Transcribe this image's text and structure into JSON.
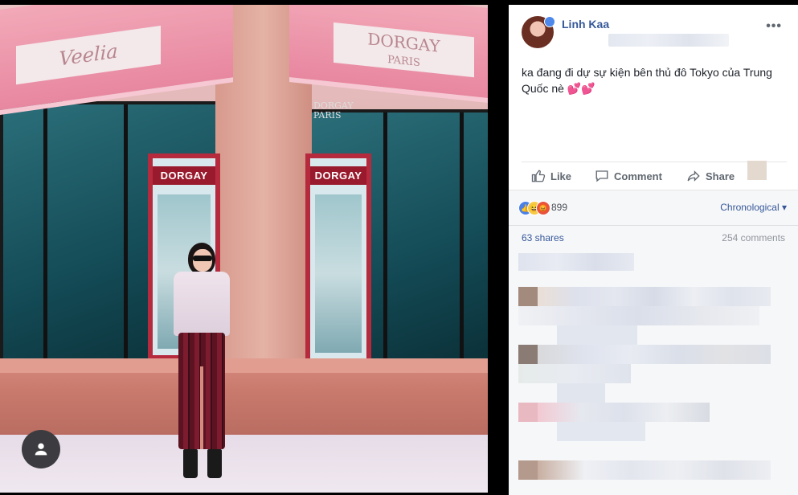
{
  "photo": {
    "awning_left_text": "Veelia",
    "awning_right_top": "DORGAY",
    "awning_right_sub": "PARIS",
    "store_sign": "DORGAY",
    "store_sign_sub": "PARIS",
    "poster_left_title": "DORGAY",
    "poster_right_title": "DORGAY",
    "badge_icon": "person-icon"
  },
  "post": {
    "author": "Linh Kaa",
    "more_icon": "•••",
    "text": "ka đang đi dự sự kiện bên thủ đô Tokyo của Trung Quốc nè",
    "emoji": "💕💕",
    "actions": {
      "like": "Like",
      "comment": "Comment",
      "share": "Share"
    },
    "reaction_count": "899",
    "sort_label": "Chronological",
    "sort_caret": "▾",
    "shares": "63 shares",
    "comments": "254 comments"
  },
  "colors": {
    "link": "#365899",
    "like_reaction": "#4a81e8",
    "haha_reaction": "#f7c945",
    "angry_reaction": "#e8533d"
  }
}
